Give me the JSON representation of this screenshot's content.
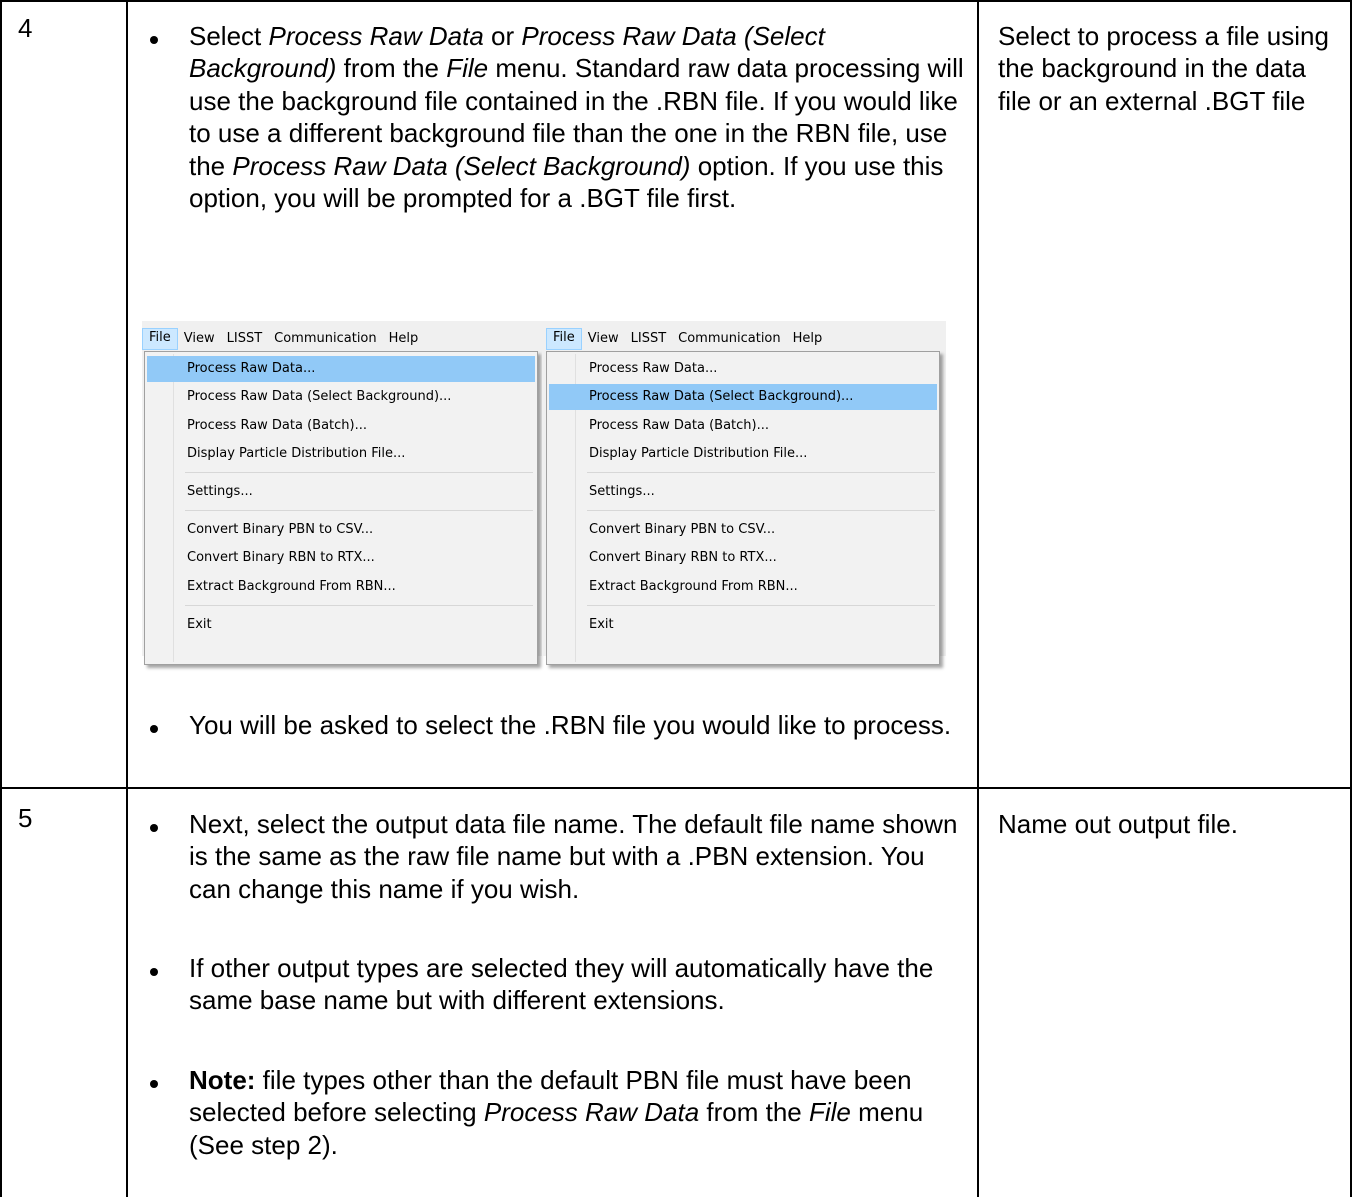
{
  "rows": [
    {
      "step": "4",
      "paragraphs": {
        "p1": {
          "t1": "Select ",
          "t2": "Process Raw Data",
          "t3": " or ",
          "t4": "Process Raw Data (Select Background)",
          "t5": " from the ",
          "t6": "File",
          "t7": " menu. Standard raw data processing will use the background file contained in the .RBN file. If you would like to use a different background file than the one in the RBN file, use the ",
          "t8": "Process Raw Data (Select Background)",
          "t9": " option. If you use this option, you will be prompted for a .BGT file first."
        },
        "p2": "You will be asked to select the .RBN file you would like to process."
      },
      "note": "Select to process a file using the background in the data file or an external .BGT file"
    },
    {
      "step": "5",
      "paragraphs": {
        "p1": "Next, select the output data file name. The default file name shown is the same as the raw file name but with a .PBN extension.  You can change this name if you wish.",
        "p2": "If other output types are selected they will automatically have the same base name but with different extensions.",
        "p3": {
          "bold": "Note:",
          "t1": " file types other than the default PBN file must have been selected before selecting ",
          "t2": "Process Raw Data",
          "t3": " from the ",
          "t4": "File",
          "t5": " menu (See step 2)."
        }
      },
      "note": "Name out output file."
    }
  ],
  "menu_screenshots": [
    {
      "menubar": [
        "File",
        "View",
        "LISST",
        "Communication",
        "Help"
      ],
      "items": {
        "process_raw": "Process Raw Data...",
        "process_raw_bg": "Process Raw Data (Select Background)...",
        "process_raw_batch": "Process Raw Data (Batch)...",
        "display_ppd": "Display Particle Distribution File...",
        "settings": "Settings...",
        "convert_pbn": "Convert Binary PBN to CSV...",
        "convert_rbn": "Convert Binary RBN to RTX...",
        "extract_bg": "Extract Background From RBN...",
        "exit": "Exit"
      },
      "highlighted": "Process Raw Data..."
    },
    {
      "menubar": [
        "File",
        "View",
        "LISST",
        "Communication",
        "Help"
      ],
      "items": {
        "process_raw": "Process Raw Data...",
        "process_raw_bg": "Process Raw Data (Select Background)...",
        "process_raw_batch": "Process Raw Data (Batch)...",
        "display_ppd": "Display Particle Distribution File...",
        "settings": "Settings...",
        "convert_pbn": "Convert Binary PBN to CSV...",
        "convert_rbn": "Convert Binary RBN to RTX...",
        "extract_bg": "Extract Background From RBN...",
        "exit": "Exit"
      },
      "highlighted": "Process Raw Data (Select Background)..."
    }
  ],
  "colors": {
    "menu_highlight": "#91c9f7",
    "menubar_active": "#cce8ff",
    "menu_background": "#f2f2f2"
  }
}
